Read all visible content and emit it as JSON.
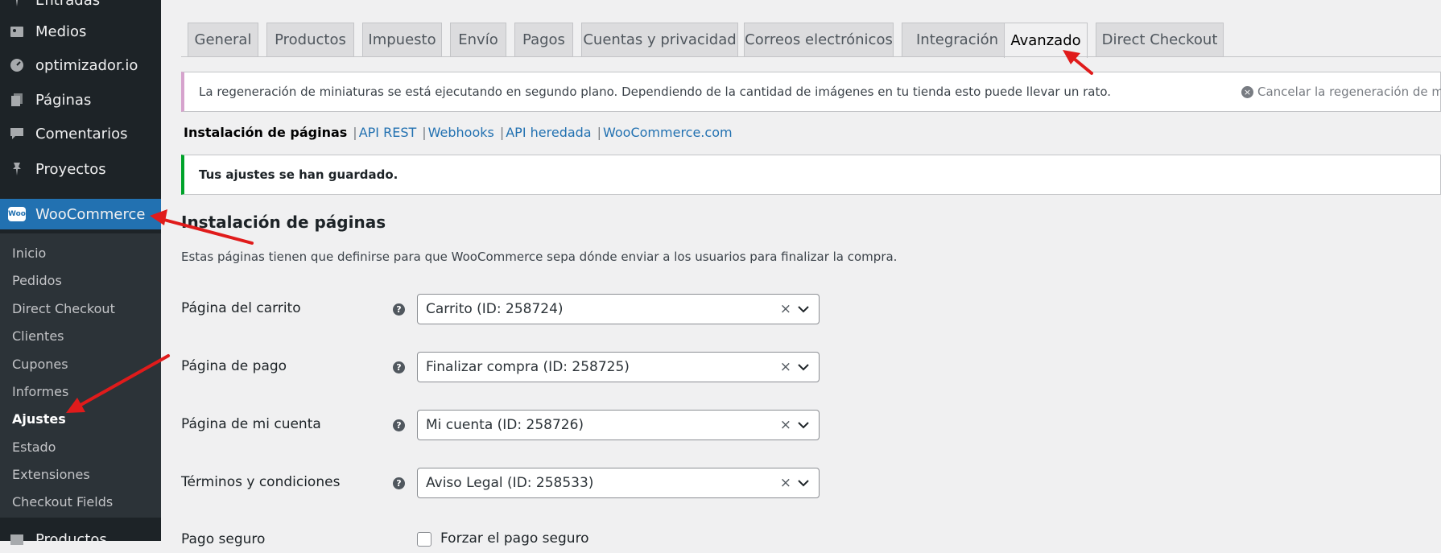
{
  "sidebar": {
    "items": [
      {
        "label": "Entradas",
        "icon": "pin-icon"
      },
      {
        "label": "Medios",
        "icon": "media-icon"
      },
      {
        "label": "optimizador.io",
        "icon": "gauge-icon"
      },
      {
        "label": "Páginas",
        "icon": "pages-icon"
      },
      {
        "label": "Comentarios",
        "icon": "comment-icon"
      },
      {
        "label": "Proyectos",
        "icon": "pin-icon"
      },
      {
        "label": "WooCommerce",
        "icon": "woo-icon",
        "logo_text": "Woo"
      },
      {
        "label": "Productos",
        "icon": "box-icon"
      }
    ],
    "submenu": [
      "Inicio",
      "Pedidos",
      "Direct Checkout",
      "Clientes",
      "Cupones",
      "Informes",
      "Ajustes",
      "Estado",
      "Extensiones",
      "Checkout Fields"
    ]
  },
  "tabs": [
    "General",
    "Productos",
    "Impuesto",
    "Envío",
    "Pagos",
    "Cuentas y privacidad",
    "Correos electrónicos",
    "Integración",
    "Avanzado",
    "Direct Checkout"
  ],
  "notice_regen": {
    "message": "La regeneración de miniaturas se está ejecutando en segundo plano. Dependiendo de la cantidad de imágenes en tu tienda esto puede llevar un rato.",
    "cancel": "Cancelar la regeneración de mi"
  },
  "subnav": {
    "current": "Instalación de páginas",
    "links": [
      "API REST",
      "Webhooks",
      "API heredada",
      "WooCommerce.com"
    ]
  },
  "notice_saved": "Tus ajustes se han guardado.",
  "section": {
    "title": "Instalación de páginas",
    "description": "Estas páginas tienen que definirse para que WooCommerce sepa dónde enviar a los usuarios para finalizar la compra."
  },
  "rows": [
    {
      "label": "Página del carrito",
      "value": "Carrito (ID: 258724)"
    },
    {
      "label": "Página de pago",
      "value": "Finalizar compra (ID: 258725)"
    },
    {
      "label": "Página de mi cuenta",
      "value": "Mi cuenta (ID: 258726)"
    },
    {
      "label": "Términos y condiciones",
      "value": "Aviso Legal (ID: 258533)"
    }
  ],
  "secure": {
    "label": "Pago seguro",
    "checkbox_label": "Forzar el pago seguro"
  },
  "glyphs": {
    "help": "?",
    "clear": "×",
    "close": "×"
  },
  "colors": {
    "sidebar": "#1d2327",
    "accent": "#2271b1",
    "success": "#00a32a",
    "arrow": "#e01b1b"
  }
}
